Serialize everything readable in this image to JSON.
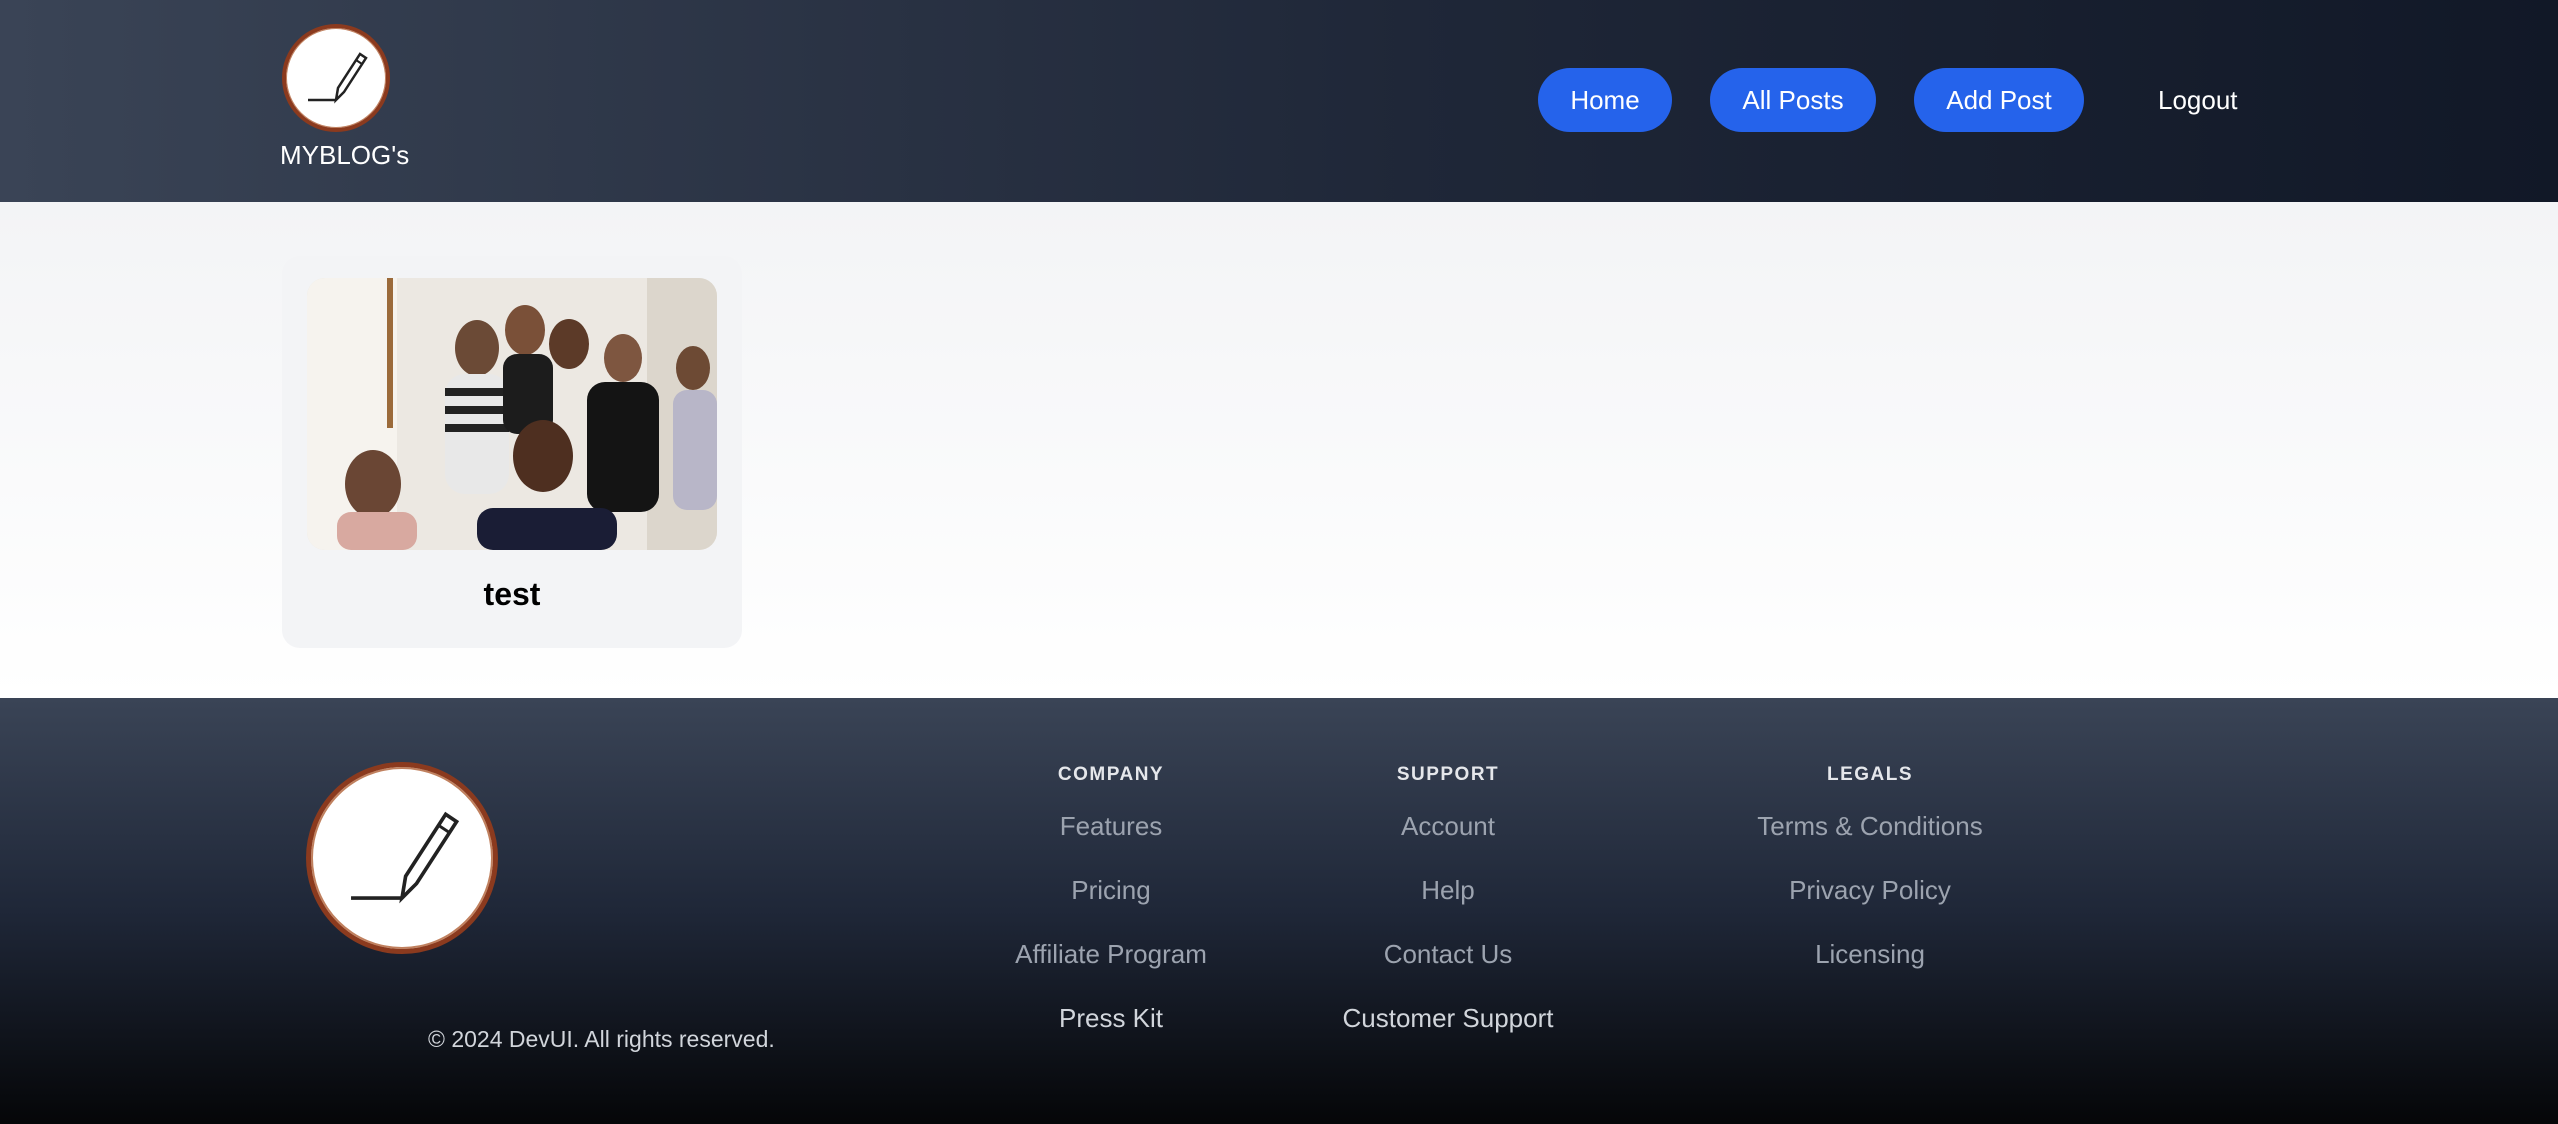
{
  "header": {
    "brand": "MYBLOG's",
    "nav": {
      "home": "Home",
      "all_posts": "All Posts",
      "add_post": "Add Post",
      "logout": "Logout"
    }
  },
  "posts": [
    {
      "title": "test",
      "image": "group-selfie-photo"
    }
  ],
  "footer": {
    "copyright": "© 2024 DevUI. All rights reserved.",
    "columns": [
      {
        "heading": "COMPANY",
        "links": [
          "Features",
          "Pricing",
          "Affiliate Program",
          "Press Kit"
        ]
      },
      {
        "heading": "SUPPORT",
        "links": [
          "Account",
          "Help",
          "Contact Us",
          "Customer Support"
        ]
      },
      {
        "heading": "LEGALS",
        "links": [
          "Terms & Conditions",
          "Privacy Policy",
          "Licensing"
        ]
      }
    ]
  },
  "colors": {
    "primary_button": "#2563eb",
    "dark_bg": "#1f2738",
    "logo_ring": "#8b3a1e"
  }
}
